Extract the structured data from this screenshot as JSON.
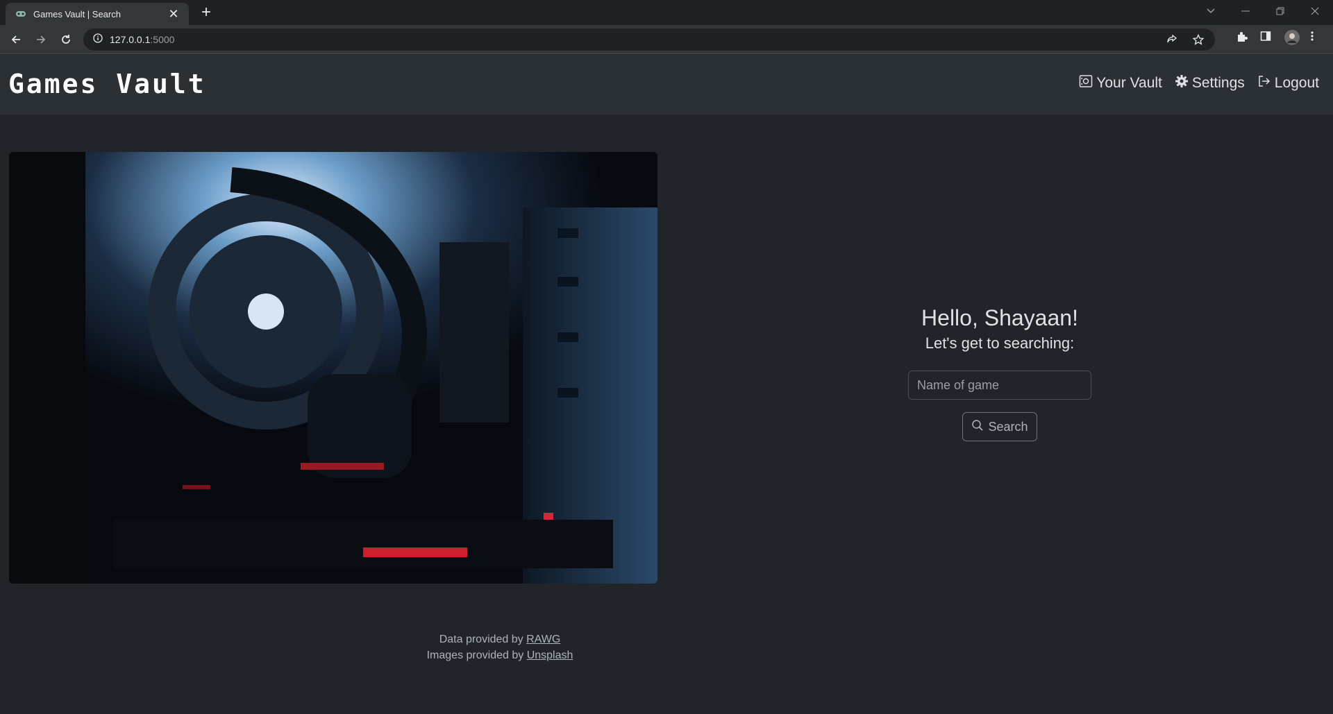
{
  "browser": {
    "tab_title": "Games Vault | Search",
    "url_host": "127.0.0.1",
    "url_port": ":5000"
  },
  "site": {
    "brand": "Games Vault",
    "nav": {
      "vault": "Your Vault",
      "settings": "Settings",
      "logout": "Logout"
    }
  },
  "main": {
    "greeting": "Hello, Shayaan!",
    "subtitle": "Let's get to searching:",
    "search_placeholder": "Name of game",
    "search_button": "Search"
  },
  "footer": {
    "data_text": "Data provided by ",
    "data_link": "RAWG",
    "images_text": "Images provided by ",
    "images_link": "Unsplash"
  },
  "icons": {
    "tab_favicon": "gamepad-icon",
    "vault": "vault-icon",
    "settings": "gear-icon",
    "logout": "logout-icon",
    "search": "search-icon"
  },
  "colors": {
    "page_bg": "#212529",
    "nav_bg": "#2b3035",
    "text": "#dee2e6"
  }
}
